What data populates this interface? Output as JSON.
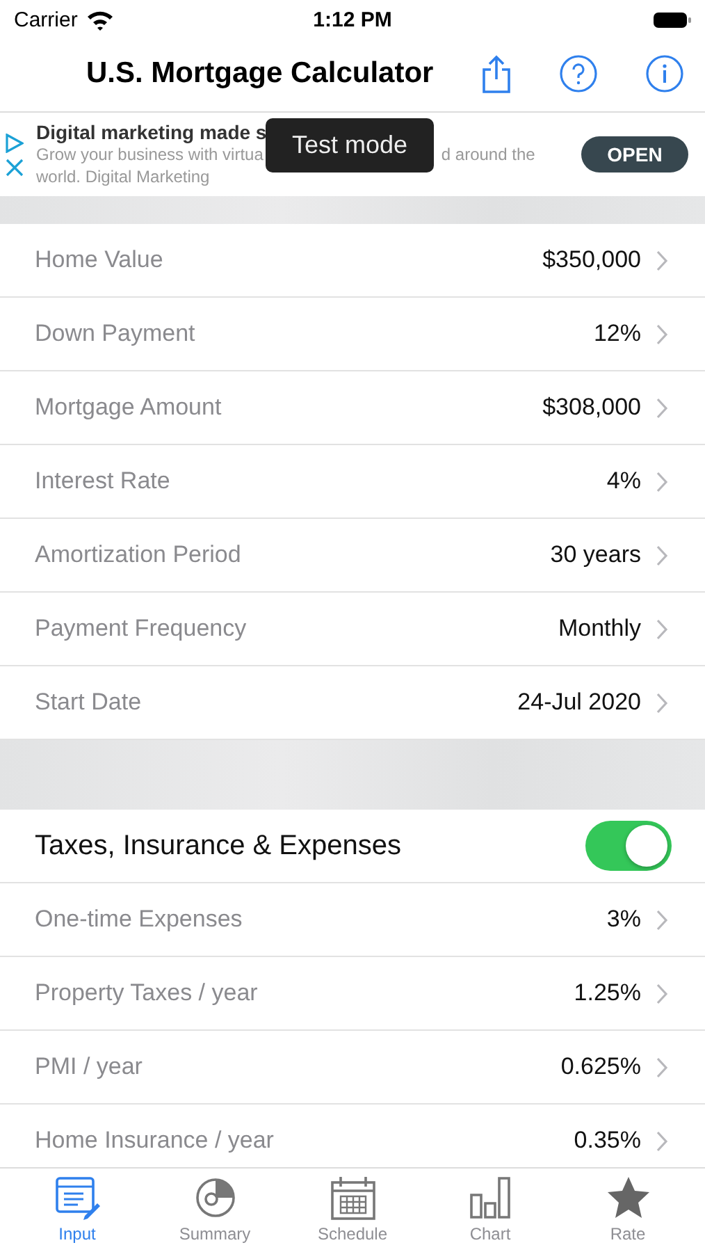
{
  "status_bar": {
    "carrier": "Carrier",
    "time": "1:12 PM"
  },
  "nav_bar": {
    "title": "U.S. Mortgage Calculator"
  },
  "ad": {
    "headline": "Digital marketing made s",
    "body_left": "Grow your business with virtua",
    "body_right": "d around the",
    "body_line2": "world. Digital Marketing",
    "button": "OPEN",
    "toast": "Test mode"
  },
  "sections": [
    {
      "rows": [
        {
          "kind": "detail",
          "label": "Home Value",
          "value": "$350,000"
        },
        {
          "kind": "detail",
          "label": "Down Payment",
          "value": "12%"
        },
        {
          "kind": "detail",
          "label": "Mortgage Amount",
          "value": "$308,000"
        },
        {
          "kind": "detail",
          "label": "Interest Rate",
          "value": "4%"
        },
        {
          "kind": "detail",
          "label": "Amortization Period",
          "value": "30 years"
        },
        {
          "kind": "detail",
          "label": "Payment Frequency",
          "value": "Monthly"
        },
        {
          "kind": "detail",
          "label": "Start Date",
          "value": "24-Jul 2020"
        }
      ]
    },
    {
      "rows": [
        {
          "kind": "toggle",
          "label": "Taxes, Insurance & Expenses",
          "on": true
        },
        {
          "kind": "detail",
          "label": "One-time Expenses",
          "value": "3%"
        },
        {
          "kind": "detail",
          "label": "Property Taxes / year",
          "value": "1.25%"
        },
        {
          "kind": "detail",
          "label": "PMI / year",
          "value": "0.625%"
        },
        {
          "kind": "detail",
          "label": "Home Insurance / year",
          "value": "0.35%"
        }
      ]
    }
  ],
  "tab_bar": [
    {
      "kind": "input",
      "label": "Input",
      "selected": true
    },
    {
      "kind": "summary",
      "label": "Summary",
      "selected": false
    },
    {
      "kind": "schedule",
      "label": "Schedule",
      "selected": false
    },
    {
      "kind": "chart",
      "label": "Chart",
      "selected": false
    },
    {
      "kind": "rate",
      "label": "Rate",
      "selected": false
    }
  ]
}
